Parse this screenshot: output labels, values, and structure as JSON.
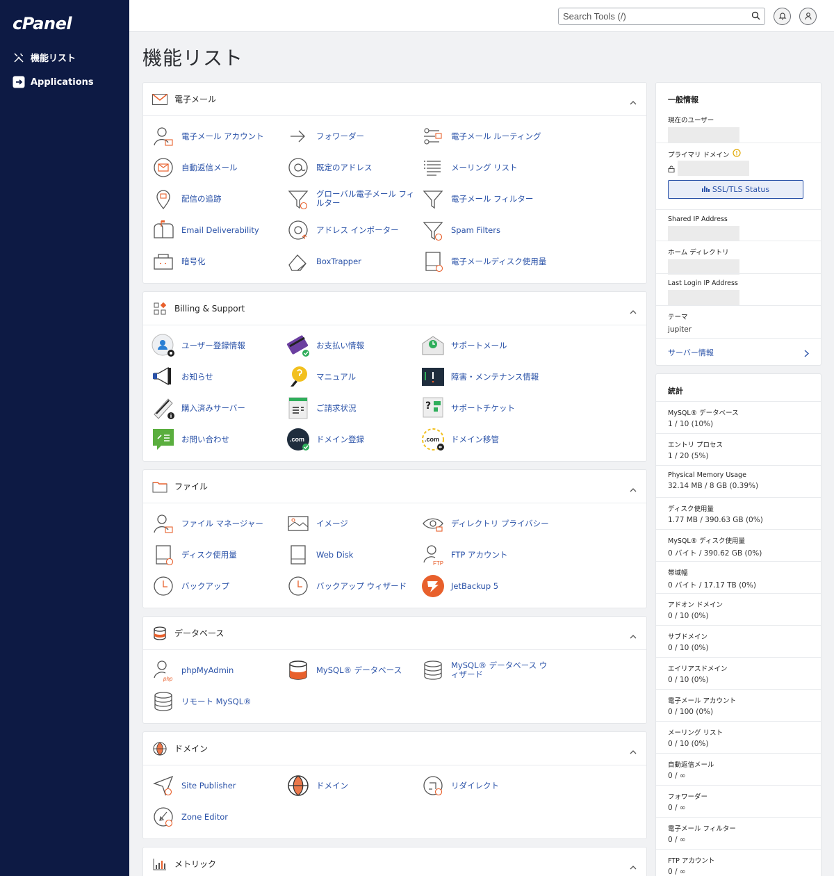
{
  "brand": {
    "logo": "cPanel",
    "accent": "#2a52a8",
    "sidebar_bg": "#0d1a44",
    "orange": "#e8602c"
  },
  "sidebar": {
    "items": [
      {
        "label": "機能リスト",
        "icon": "tools-icon"
      },
      {
        "label": "Applications",
        "icon": "applications-icon"
      }
    ]
  },
  "topbar": {
    "search_placeholder": "Search Tools (/)"
  },
  "page_title": "機能リスト",
  "sections": {
    "email": {
      "title": "電子メール",
      "tools": [
        "電子メール アカウント",
        "フォワーダー",
        "電子メール ルーティング",
        "自動返信メール",
        "既定のアドレス",
        "メーリング リスト",
        "配信の追跡",
        "グローバル電子メール フィルター",
        "電子メール フィルター",
        "Email Deliverability",
        "アドレス インポーター",
        "Spam Filters",
        "暗号化",
        "BoxTrapper",
        "電子メールディスク使用量"
      ]
    },
    "billing": {
      "title": "Billing & Support",
      "tools": [
        "ユーザー登録情報",
        "お支払い情報",
        "サポートメール",
        "お知らせ",
        "マニュアル",
        "障害・メンテナンス情報",
        "購入済みサーバー",
        "ご請求状況",
        "サポートチケット",
        "お問い合わせ",
        "ドメイン登録",
        "ドメイン移管"
      ]
    },
    "files": {
      "title": "ファイル",
      "tools": [
        "ファイル マネージャー",
        "イメージ",
        "ディレクトリ プライバシー",
        "ディスク使用量",
        "Web Disk",
        "FTP アカウント",
        "バックアップ",
        "バックアップ ウィザード",
        "JetBackup 5"
      ]
    },
    "database": {
      "title": "データベース",
      "tools": [
        "phpMyAdmin",
        "MySQL® データベース",
        "MySQL® データベース ウィザード",
        "リモート MySQL®"
      ]
    },
    "domains": {
      "title": "ドメイン",
      "tools": [
        "Site Publisher",
        "ドメイン",
        "リダイレクト",
        "Zone Editor"
      ]
    },
    "metrics": {
      "title": "メトリック"
    }
  },
  "general": {
    "title": "一般情報",
    "current_user": "現在のユーザー",
    "primary_domain": "プライマリ ドメイン",
    "ssl_button": "SSL/TLS Status",
    "shared_ip": "Shared IP Address",
    "home_dir": "ホーム ディレクトリ",
    "last_login_ip": "Last Login IP Address",
    "theme_label": "テーマ",
    "theme_value": "jupiter",
    "server_info": "サーバー情報"
  },
  "stats": {
    "title": "統計",
    "rows": [
      {
        "label": "MySQL® データベース",
        "value": "1 / 10   (10%)"
      },
      {
        "label": "エントリ プロセス",
        "value": "1 / 20   (5%)"
      },
      {
        "label": "Physical Memory Usage",
        "value": "32.14 MB / 8 GB   (0.39%)"
      },
      {
        "label": "ディスク使用量",
        "value": "1.77 MB / 390.63 GB   (0%)"
      },
      {
        "label": "MySQL® ディスク使用量",
        "value": "0 バイト / 390.62 GB   (0%)"
      },
      {
        "label": "帯域幅",
        "value": "0 バイト / 17.17 TB   (0%)"
      },
      {
        "label": "アドオン ドメイン",
        "value": "0 / 10   (0%)"
      },
      {
        "label": "サブドメイン",
        "value": "0 / 10   (0%)"
      },
      {
        "label": "エイリアスドメイン",
        "value": "0 / 10   (0%)"
      },
      {
        "label": "電子メール アカウント",
        "value": "0 / 100   (0%)"
      },
      {
        "label": "メーリング リスト",
        "value": "0 / 10   (0%)"
      },
      {
        "label": "自動返信メール",
        "value": "0 / ∞"
      },
      {
        "label": "フォワーダー",
        "value": "0 / ∞"
      },
      {
        "label": "電子メール フィルター",
        "value": "0 / ∞"
      },
      {
        "label": "FTP アカウント",
        "value": "0 / ∞"
      }
    ]
  }
}
